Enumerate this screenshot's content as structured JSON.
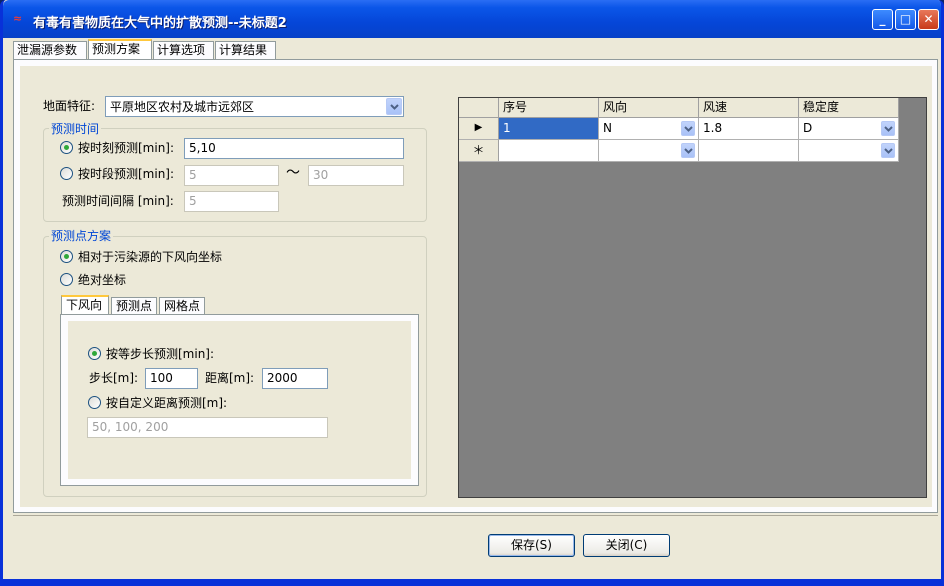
{
  "window": {
    "title": "有毒有害物质在大气中的扩散预测--未标题2",
    "icon": "app-logo-icon",
    "controls": [
      "minimize-icon",
      "maximize-icon",
      "close-icon"
    ]
  },
  "tabs": [
    {
      "label": "泄漏源参数",
      "active": false
    },
    {
      "label": "预测方案",
      "active": true
    },
    {
      "label": "计算选项",
      "active": false
    },
    {
      "label": "计算结果",
      "active": false
    }
  ],
  "form": {
    "terrain_label": "地面特征:",
    "terrain_value": "平原地区农村及城市远郊区",
    "time_group_title": "预测时间",
    "time_by_moment_label": "按时刻预测[min]:",
    "time_by_moment_value": "5,10",
    "time_by_moment_checked": true,
    "time_by_period_label": "按时段预测[min]:",
    "time_by_period_from": "5",
    "time_by_period_to": "30",
    "time_by_period_checked": false,
    "tilde": "～",
    "time_interval_label": "预测时间间隔 [min]:",
    "time_interval_value": "5",
    "point_group_title": "预测点方案",
    "relative_coord_label": "相对于污染源的下风向坐标",
    "relative_coord_checked": true,
    "absolute_coord_label": "绝对坐标",
    "absolute_coord_checked": false,
    "subtabs": [
      {
        "label": "下风向",
        "active": true
      },
      {
        "label": "预测点",
        "active": false
      },
      {
        "label": "网格点",
        "active": false
      }
    ],
    "step_predict_label": "按等步长预测[min]:",
    "step_predict_checked": true,
    "step_label": "步长[m]:",
    "step_value": "100",
    "distance_label": "距离[m]:",
    "distance_value": "2000",
    "custom_distance_label": "按自定义距离预测[m]:",
    "custom_distance_checked": false,
    "custom_distance_value": "50, 100, 200"
  },
  "grid": {
    "columns": [
      "序号",
      "风向",
      "风速",
      "稳定度"
    ],
    "rows": [
      {
        "indicator": "▶",
        "cells": [
          "1",
          "N",
          "1.8",
          "D"
        ]
      },
      {
        "indicator": "＊",
        "cells": [
          "",
          "",
          "",
          ""
        ]
      }
    ]
  },
  "buttons": {
    "save": "保存(S)",
    "close": "关闭(C)"
  }
}
